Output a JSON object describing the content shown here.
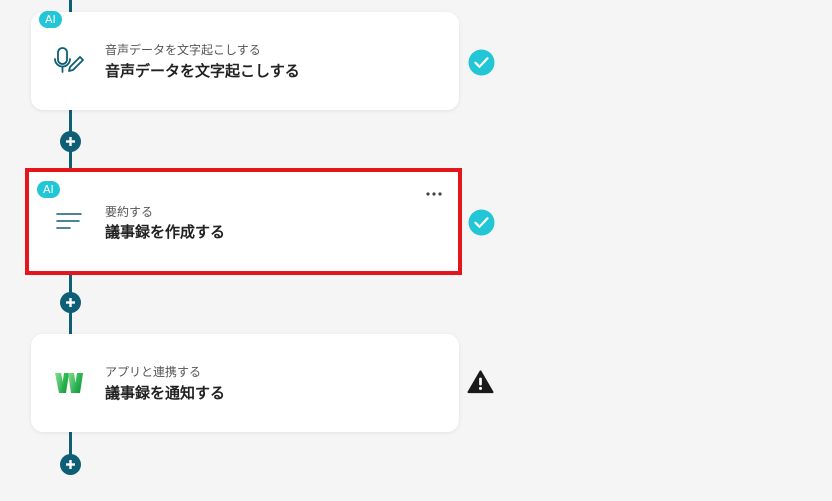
{
  "flow": {
    "steps": [
      {
        "badge": "AI",
        "subtitle": "音声データを文字起こしする",
        "title": "音声データを文字起こしする",
        "icon": "microphone-pen-icon",
        "status": "success",
        "selected": false
      },
      {
        "badge": "AI",
        "subtitle": "要約する",
        "title": "議事録を作成する",
        "icon": "text-lines-icon",
        "status": "success",
        "selected": true
      },
      {
        "badge": "",
        "subtitle": "アプリと連携する",
        "title": "議事録を通知する",
        "icon": "w-app-logo-icon",
        "status": "warning",
        "selected": false
      }
    ]
  },
  "colors": {
    "background": "#f5f5f5",
    "connector": "#0e5f75",
    "ai_badge": "#22c6d6",
    "success": "#22c6d6",
    "warning": "#1a1a1a",
    "selection": "#e5151c"
  }
}
